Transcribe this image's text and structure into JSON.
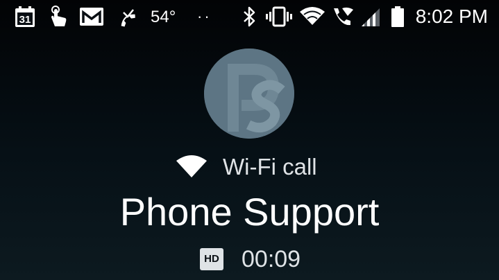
{
  "status_bar": {
    "calendar_day": "31",
    "temperature": "54°",
    "overflow_dots": "··",
    "time": "8:02 PM",
    "icons": [
      "calendar-icon",
      "hand-tap-icon",
      "gmail-icon",
      "missed-call-icon",
      "bluetooth-icon",
      "vibrate-icon",
      "wifi-icon",
      "wifi-calling-icon",
      "cell-signal-icon",
      "battery-icon"
    ]
  },
  "call": {
    "type_label": "Wi-Fi call",
    "contact_name": "Phone Support",
    "hd_label": "HD",
    "duration": "00:09"
  },
  "colors": {
    "background": "#0a0f14",
    "avatar": "#5d7584",
    "text": "#ffffff",
    "secondary_text": "#dfe3e6"
  }
}
